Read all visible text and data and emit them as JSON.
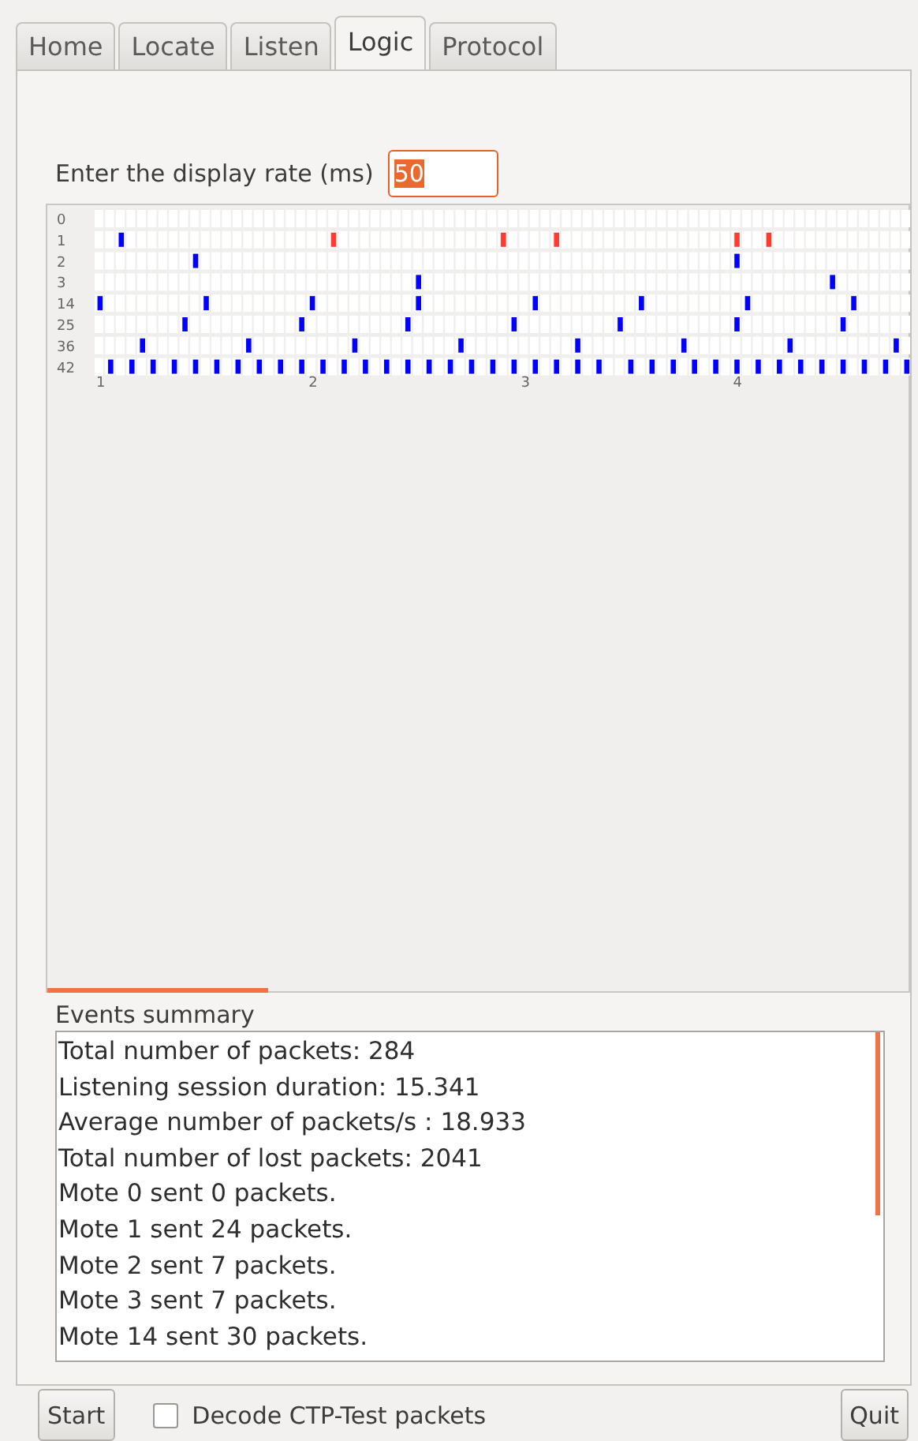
{
  "tabs": [
    {
      "label": "Home",
      "selected": false
    },
    {
      "label": "Locate",
      "selected": false
    },
    {
      "label": "Listen",
      "selected": false
    },
    {
      "label": "Logic",
      "selected": true
    },
    {
      "label": "Protocol",
      "selected": false
    }
  ],
  "rate": {
    "label": "Enter the display rate (ms)",
    "value": "50"
  },
  "logic_view": {
    "rows": [
      {
        "label": "0",
        "cells": [
          {
            "kind": "none"
          },
          {
            "kind": "none"
          },
          {
            "kind": "none"
          },
          {
            "kind": "none"
          },
          {
            "kind": "none"
          },
          {
            "kind": "none"
          },
          {
            "kind": "none"
          },
          {
            "kind": "none"
          },
          {
            "kind": "none"
          },
          {
            "kind": "none"
          },
          {
            "kind": "none"
          },
          {
            "kind": "none"
          },
          {
            "kind": "none"
          },
          {
            "kind": "none"
          },
          {
            "kind": "none"
          },
          {
            "kind": "none"
          },
          {
            "kind": "none"
          },
          {
            "kind": "none"
          },
          {
            "kind": "none"
          },
          {
            "kind": "none"
          },
          {
            "kind": "none"
          },
          {
            "kind": "none"
          },
          {
            "kind": "none"
          },
          {
            "kind": "none"
          },
          {
            "kind": "none"
          },
          {
            "kind": "none"
          },
          {
            "kind": "none"
          },
          {
            "kind": "none"
          },
          {
            "kind": "none"
          },
          {
            "kind": "none"
          },
          {
            "kind": "none"
          },
          {
            "kind": "none"
          },
          {
            "kind": "none"
          },
          {
            "kind": "none"
          },
          {
            "kind": "none"
          },
          {
            "kind": "none"
          },
          {
            "kind": "none"
          },
          {
            "kind": "none"
          },
          {
            "kind": "none"
          },
          {
            "kind": "none"
          },
          {
            "kind": "none"
          },
          {
            "kind": "none"
          },
          {
            "kind": "none"
          },
          {
            "kind": "none"
          },
          {
            "kind": "none"
          },
          {
            "kind": "none"
          },
          {
            "kind": "none"
          },
          {
            "kind": "none"
          },
          {
            "kind": "none"
          },
          {
            "kind": "none"
          },
          {
            "kind": "none"
          },
          {
            "kind": "none"
          },
          {
            "kind": "none"
          },
          {
            "kind": "none"
          },
          {
            "kind": "none"
          },
          {
            "kind": "none"
          },
          {
            "kind": "none"
          },
          {
            "kind": "none"
          },
          {
            "kind": "none"
          },
          {
            "kind": "none"
          },
          {
            "kind": "none"
          },
          {
            "kind": "none"
          },
          {
            "kind": "none"
          },
          {
            "kind": "none"
          },
          {
            "kind": "none"
          },
          {
            "kind": "none"
          },
          {
            "kind": "none"
          },
          {
            "kind": "none"
          },
          {
            "kind": "none"
          },
          {
            "kind": "none"
          },
          {
            "kind": "none"
          },
          {
            "kind": "none"
          },
          {
            "kind": "none"
          },
          {
            "kind": "none"
          },
          {
            "kind": "none"
          },
          {
            "kind": "none"
          },
          {
            "kind": "none"
          }
        ]
      },
      {
        "label": "1",
        "cells": [
          {
            "kind": "none"
          },
          {
            "kind": "none"
          },
          {
            "kind": "rx"
          },
          {
            "kind": "none"
          },
          {
            "kind": "none"
          },
          {
            "kind": "none"
          },
          {
            "kind": "none"
          },
          {
            "kind": "none"
          },
          {
            "kind": "none"
          },
          {
            "kind": "none"
          },
          {
            "kind": "none"
          },
          {
            "kind": "none"
          },
          {
            "kind": "none"
          },
          {
            "kind": "none"
          },
          {
            "kind": "none"
          },
          {
            "kind": "none"
          },
          {
            "kind": "none"
          },
          {
            "kind": "none"
          },
          {
            "kind": "none"
          },
          {
            "kind": "none"
          },
          {
            "kind": "none"
          },
          {
            "kind": "none"
          },
          {
            "kind": "lost"
          },
          {
            "kind": "none"
          },
          {
            "kind": "none"
          },
          {
            "kind": "none"
          },
          {
            "kind": "none"
          },
          {
            "kind": "none"
          },
          {
            "kind": "none"
          },
          {
            "kind": "none"
          },
          {
            "kind": "none"
          },
          {
            "kind": "none"
          },
          {
            "kind": "none"
          },
          {
            "kind": "none"
          },
          {
            "kind": "none"
          },
          {
            "kind": "none"
          },
          {
            "kind": "none"
          },
          {
            "kind": "none"
          },
          {
            "kind": "lost"
          },
          {
            "kind": "none"
          },
          {
            "kind": "none"
          },
          {
            "kind": "none"
          },
          {
            "kind": "none"
          },
          {
            "kind": "lost"
          },
          {
            "kind": "none"
          },
          {
            "kind": "none"
          },
          {
            "kind": "none"
          },
          {
            "kind": "none"
          },
          {
            "kind": "none"
          },
          {
            "kind": "none"
          },
          {
            "kind": "none"
          },
          {
            "kind": "none"
          },
          {
            "kind": "none"
          },
          {
            "kind": "none"
          },
          {
            "kind": "none"
          },
          {
            "kind": "none"
          },
          {
            "kind": "none"
          },
          {
            "kind": "none"
          },
          {
            "kind": "none"
          },
          {
            "kind": "none"
          },
          {
            "kind": "lost"
          },
          {
            "kind": "none"
          },
          {
            "kind": "none"
          },
          {
            "kind": "lost"
          },
          {
            "kind": "none"
          },
          {
            "kind": "none"
          },
          {
            "kind": "none"
          },
          {
            "kind": "none"
          },
          {
            "kind": "none"
          },
          {
            "kind": "none"
          },
          {
            "kind": "none"
          },
          {
            "kind": "none"
          },
          {
            "kind": "none"
          },
          {
            "kind": "none"
          },
          {
            "kind": "none"
          },
          {
            "kind": "none"
          },
          {
            "kind": "none"
          }
        ]
      },
      {
        "label": "2",
        "cells": [
          {
            "kind": "none"
          },
          {
            "kind": "none"
          },
          {
            "kind": "none"
          },
          {
            "kind": "none"
          },
          {
            "kind": "none"
          },
          {
            "kind": "none"
          },
          {
            "kind": "none"
          },
          {
            "kind": "none"
          },
          {
            "kind": "none"
          },
          {
            "kind": "rx"
          },
          {
            "kind": "none"
          },
          {
            "kind": "none"
          },
          {
            "kind": "none"
          },
          {
            "kind": "none"
          },
          {
            "kind": "none"
          },
          {
            "kind": "none"
          },
          {
            "kind": "none"
          },
          {
            "kind": "none"
          },
          {
            "kind": "none"
          },
          {
            "kind": "none"
          },
          {
            "kind": "none"
          },
          {
            "kind": "none"
          },
          {
            "kind": "none"
          },
          {
            "kind": "none"
          },
          {
            "kind": "none"
          },
          {
            "kind": "none"
          },
          {
            "kind": "none"
          },
          {
            "kind": "none"
          },
          {
            "kind": "none"
          },
          {
            "kind": "none"
          },
          {
            "kind": "none"
          },
          {
            "kind": "none"
          },
          {
            "kind": "none"
          },
          {
            "kind": "none"
          },
          {
            "kind": "none"
          },
          {
            "kind": "none"
          },
          {
            "kind": "none"
          },
          {
            "kind": "none"
          },
          {
            "kind": "none"
          },
          {
            "kind": "none"
          },
          {
            "kind": "none"
          },
          {
            "kind": "none"
          },
          {
            "kind": "none"
          },
          {
            "kind": "none"
          },
          {
            "kind": "none"
          },
          {
            "kind": "none"
          },
          {
            "kind": "none"
          },
          {
            "kind": "none"
          },
          {
            "kind": "none"
          },
          {
            "kind": "none"
          },
          {
            "kind": "none"
          },
          {
            "kind": "none"
          },
          {
            "kind": "none"
          },
          {
            "kind": "none"
          },
          {
            "kind": "none"
          },
          {
            "kind": "none"
          },
          {
            "kind": "none"
          },
          {
            "kind": "none"
          },
          {
            "kind": "none"
          },
          {
            "kind": "none"
          },
          {
            "kind": "rx"
          },
          {
            "kind": "none"
          },
          {
            "kind": "none"
          },
          {
            "kind": "none"
          },
          {
            "kind": "none"
          },
          {
            "kind": "none"
          },
          {
            "kind": "none"
          },
          {
            "kind": "none"
          },
          {
            "kind": "none"
          },
          {
            "kind": "none"
          },
          {
            "kind": "none"
          },
          {
            "kind": "none"
          },
          {
            "kind": "none"
          },
          {
            "kind": "none"
          },
          {
            "kind": "none"
          },
          {
            "kind": "none"
          },
          {
            "kind": "none"
          }
        ]
      },
      {
        "label": "3",
        "cells": [
          {
            "kind": "none"
          },
          {
            "kind": "none"
          },
          {
            "kind": "none"
          },
          {
            "kind": "none"
          },
          {
            "kind": "none"
          },
          {
            "kind": "none"
          },
          {
            "kind": "none"
          },
          {
            "kind": "none"
          },
          {
            "kind": "none"
          },
          {
            "kind": "none"
          },
          {
            "kind": "none"
          },
          {
            "kind": "none"
          },
          {
            "kind": "none"
          },
          {
            "kind": "none"
          },
          {
            "kind": "none"
          },
          {
            "kind": "none"
          },
          {
            "kind": "none"
          },
          {
            "kind": "none"
          },
          {
            "kind": "none"
          },
          {
            "kind": "none"
          },
          {
            "kind": "none"
          },
          {
            "kind": "none"
          },
          {
            "kind": "none"
          },
          {
            "kind": "none"
          },
          {
            "kind": "none"
          },
          {
            "kind": "none"
          },
          {
            "kind": "none"
          },
          {
            "kind": "none"
          },
          {
            "kind": "none"
          },
          {
            "kind": "none"
          },
          {
            "kind": "rx"
          },
          {
            "kind": "none"
          },
          {
            "kind": "none"
          },
          {
            "kind": "none"
          },
          {
            "kind": "none"
          },
          {
            "kind": "none"
          },
          {
            "kind": "none"
          },
          {
            "kind": "none"
          },
          {
            "kind": "none"
          },
          {
            "kind": "none"
          },
          {
            "kind": "none"
          },
          {
            "kind": "none"
          },
          {
            "kind": "none"
          },
          {
            "kind": "none"
          },
          {
            "kind": "none"
          },
          {
            "kind": "none"
          },
          {
            "kind": "none"
          },
          {
            "kind": "none"
          },
          {
            "kind": "none"
          },
          {
            "kind": "none"
          },
          {
            "kind": "none"
          },
          {
            "kind": "none"
          },
          {
            "kind": "none"
          },
          {
            "kind": "none"
          },
          {
            "kind": "none"
          },
          {
            "kind": "none"
          },
          {
            "kind": "none"
          },
          {
            "kind": "none"
          },
          {
            "kind": "none"
          },
          {
            "kind": "none"
          },
          {
            "kind": "none"
          },
          {
            "kind": "none"
          },
          {
            "kind": "none"
          },
          {
            "kind": "none"
          },
          {
            "kind": "none"
          },
          {
            "kind": "none"
          },
          {
            "kind": "none"
          },
          {
            "kind": "none"
          },
          {
            "kind": "none"
          },
          {
            "kind": "rx"
          },
          {
            "kind": "none"
          },
          {
            "kind": "none"
          },
          {
            "kind": "none"
          },
          {
            "kind": "none"
          },
          {
            "kind": "none"
          },
          {
            "kind": "none"
          },
          {
            "kind": "none"
          }
        ]
      },
      {
        "label": "14",
        "cells": [
          {
            "kind": "rx"
          },
          {
            "kind": "none"
          },
          {
            "kind": "none"
          },
          {
            "kind": "none"
          },
          {
            "kind": "none"
          },
          {
            "kind": "none"
          },
          {
            "kind": "none"
          },
          {
            "kind": "none"
          },
          {
            "kind": "none"
          },
          {
            "kind": "none"
          },
          {
            "kind": "rx"
          },
          {
            "kind": "none"
          },
          {
            "kind": "none"
          },
          {
            "kind": "none"
          },
          {
            "kind": "none"
          },
          {
            "kind": "none"
          },
          {
            "kind": "none"
          },
          {
            "kind": "none"
          },
          {
            "kind": "none"
          },
          {
            "kind": "none"
          },
          {
            "kind": "rx"
          },
          {
            "kind": "none"
          },
          {
            "kind": "none"
          },
          {
            "kind": "none"
          },
          {
            "kind": "none"
          },
          {
            "kind": "none"
          },
          {
            "kind": "none"
          },
          {
            "kind": "none"
          },
          {
            "kind": "none"
          },
          {
            "kind": "none"
          },
          {
            "kind": "rx"
          },
          {
            "kind": "none"
          },
          {
            "kind": "none"
          },
          {
            "kind": "none"
          },
          {
            "kind": "none"
          },
          {
            "kind": "none"
          },
          {
            "kind": "none"
          },
          {
            "kind": "none"
          },
          {
            "kind": "none"
          },
          {
            "kind": "none"
          },
          {
            "kind": "none"
          },
          {
            "kind": "rx"
          },
          {
            "kind": "none"
          },
          {
            "kind": "none"
          },
          {
            "kind": "none"
          },
          {
            "kind": "none"
          },
          {
            "kind": "none"
          },
          {
            "kind": "none"
          },
          {
            "kind": "none"
          },
          {
            "kind": "none"
          },
          {
            "kind": "none"
          },
          {
            "kind": "rx"
          },
          {
            "kind": "none"
          },
          {
            "kind": "none"
          },
          {
            "kind": "none"
          },
          {
            "kind": "none"
          },
          {
            "kind": "none"
          },
          {
            "kind": "none"
          },
          {
            "kind": "none"
          },
          {
            "kind": "none"
          },
          {
            "kind": "none"
          },
          {
            "kind": "rx"
          },
          {
            "kind": "none"
          },
          {
            "kind": "none"
          },
          {
            "kind": "none"
          },
          {
            "kind": "none"
          },
          {
            "kind": "none"
          },
          {
            "kind": "none"
          },
          {
            "kind": "none"
          },
          {
            "kind": "none"
          },
          {
            "kind": "none"
          },
          {
            "kind": "rx"
          },
          {
            "kind": "none"
          },
          {
            "kind": "none"
          },
          {
            "kind": "none"
          },
          {
            "kind": "none"
          },
          {
            "kind": "none"
          }
        ]
      },
      {
        "label": "25",
        "cells": [
          {
            "kind": "none"
          },
          {
            "kind": "none"
          },
          {
            "kind": "none"
          },
          {
            "kind": "none"
          },
          {
            "kind": "none"
          },
          {
            "kind": "none"
          },
          {
            "kind": "none"
          },
          {
            "kind": "none"
          },
          {
            "kind": "rx"
          },
          {
            "kind": "none"
          },
          {
            "kind": "none"
          },
          {
            "kind": "none"
          },
          {
            "kind": "none"
          },
          {
            "kind": "none"
          },
          {
            "kind": "none"
          },
          {
            "kind": "none"
          },
          {
            "kind": "none"
          },
          {
            "kind": "none"
          },
          {
            "kind": "none"
          },
          {
            "kind": "rx"
          },
          {
            "kind": "none"
          },
          {
            "kind": "none"
          },
          {
            "kind": "none"
          },
          {
            "kind": "none"
          },
          {
            "kind": "none"
          },
          {
            "kind": "none"
          },
          {
            "kind": "none"
          },
          {
            "kind": "none"
          },
          {
            "kind": "none"
          },
          {
            "kind": "rx"
          },
          {
            "kind": "none"
          },
          {
            "kind": "none"
          },
          {
            "kind": "none"
          },
          {
            "kind": "none"
          },
          {
            "kind": "none"
          },
          {
            "kind": "none"
          },
          {
            "kind": "none"
          },
          {
            "kind": "none"
          },
          {
            "kind": "none"
          },
          {
            "kind": "rx"
          },
          {
            "kind": "none"
          },
          {
            "kind": "none"
          },
          {
            "kind": "none"
          },
          {
            "kind": "none"
          },
          {
            "kind": "none"
          },
          {
            "kind": "none"
          },
          {
            "kind": "none"
          },
          {
            "kind": "none"
          },
          {
            "kind": "none"
          },
          {
            "kind": "rx"
          },
          {
            "kind": "none"
          },
          {
            "kind": "none"
          },
          {
            "kind": "none"
          },
          {
            "kind": "none"
          },
          {
            "kind": "none"
          },
          {
            "kind": "none"
          },
          {
            "kind": "none"
          },
          {
            "kind": "none"
          },
          {
            "kind": "none"
          },
          {
            "kind": "none"
          },
          {
            "kind": "rx"
          },
          {
            "kind": "none"
          },
          {
            "kind": "none"
          },
          {
            "kind": "none"
          },
          {
            "kind": "none"
          },
          {
            "kind": "none"
          },
          {
            "kind": "none"
          },
          {
            "kind": "none"
          },
          {
            "kind": "none"
          },
          {
            "kind": "none"
          },
          {
            "kind": "rx"
          },
          {
            "kind": "none"
          },
          {
            "kind": "none"
          },
          {
            "kind": "none"
          },
          {
            "kind": "none"
          },
          {
            "kind": "none"
          },
          {
            "kind": "none"
          }
        ]
      },
      {
        "label": "36",
        "cells": [
          {
            "kind": "none"
          },
          {
            "kind": "none"
          },
          {
            "kind": "none"
          },
          {
            "kind": "none"
          },
          {
            "kind": "rx"
          },
          {
            "kind": "none"
          },
          {
            "kind": "none"
          },
          {
            "kind": "none"
          },
          {
            "kind": "none"
          },
          {
            "kind": "none"
          },
          {
            "kind": "none"
          },
          {
            "kind": "none"
          },
          {
            "kind": "none"
          },
          {
            "kind": "none"
          },
          {
            "kind": "rx"
          },
          {
            "kind": "none"
          },
          {
            "kind": "none"
          },
          {
            "kind": "none"
          },
          {
            "kind": "none"
          },
          {
            "kind": "none"
          },
          {
            "kind": "none"
          },
          {
            "kind": "none"
          },
          {
            "kind": "none"
          },
          {
            "kind": "none"
          },
          {
            "kind": "rx"
          },
          {
            "kind": "none"
          },
          {
            "kind": "none"
          },
          {
            "kind": "none"
          },
          {
            "kind": "none"
          },
          {
            "kind": "none"
          },
          {
            "kind": "none"
          },
          {
            "kind": "none"
          },
          {
            "kind": "none"
          },
          {
            "kind": "none"
          },
          {
            "kind": "rx"
          },
          {
            "kind": "none"
          },
          {
            "kind": "none"
          },
          {
            "kind": "none"
          },
          {
            "kind": "none"
          },
          {
            "kind": "none"
          },
          {
            "kind": "none"
          },
          {
            "kind": "none"
          },
          {
            "kind": "none"
          },
          {
            "kind": "none"
          },
          {
            "kind": "none"
          },
          {
            "kind": "rx"
          },
          {
            "kind": "none"
          },
          {
            "kind": "none"
          },
          {
            "kind": "none"
          },
          {
            "kind": "none"
          },
          {
            "kind": "none"
          },
          {
            "kind": "none"
          },
          {
            "kind": "none"
          },
          {
            "kind": "none"
          },
          {
            "kind": "none"
          },
          {
            "kind": "rx"
          },
          {
            "kind": "none"
          },
          {
            "kind": "none"
          },
          {
            "kind": "none"
          },
          {
            "kind": "none"
          },
          {
            "kind": "none"
          },
          {
            "kind": "none"
          },
          {
            "kind": "none"
          },
          {
            "kind": "none"
          },
          {
            "kind": "none"
          },
          {
            "kind": "rx"
          },
          {
            "kind": "none"
          },
          {
            "kind": "none"
          },
          {
            "kind": "none"
          },
          {
            "kind": "none"
          },
          {
            "kind": "none"
          },
          {
            "kind": "none"
          },
          {
            "kind": "none"
          },
          {
            "kind": "none"
          },
          {
            "kind": "none"
          },
          {
            "kind": "rx"
          },
          {
            "kind": "none"
          }
        ]
      },
      {
        "label": "42",
        "cells": [
          {
            "kind": "none"
          },
          {
            "kind": "rx"
          },
          {
            "kind": "none"
          },
          {
            "kind": "rx"
          },
          {
            "kind": "none"
          },
          {
            "kind": "rx"
          },
          {
            "kind": "none"
          },
          {
            "kind": "rx"
          },
          {
            "kind": "none"
          },
          {
            "kind": "rx"
          },
          {
            "kind": "none"
          },
          {
            "kind": "rx"
          },
          {
            "kind": "none"
          },
          {
            "kind": "rx"
          },
          {
            "kind": "none"
          },
          {
            "kind": "rx"
          },
          {
            "kind": "none"
          },
          {
            "kind": "rx"
          },
          {
            "kind": "none"
          },
          {
            "kind": "rx"
          },
          {
            "kind": "none"
          },
          {
            "kind": "rx"
          },
          {
            "kind": "none"
          },
          {
            "kind": "rx"
          },
          {
            "kind": "none"
          },
          {
            "kind": "rx"
          },
          {
            "kind": "none"
          },
          {
            "kind": "rx"
          },
          {
            "kind": "none"
          },
          {
            "kind": "rx"
          },
          {
            "kind": "none"
          },
          {
            "kind": "rx"
          },
          {
            "kind": "none"
          },
          {
            "kind": "rx"
          },
          {
            "kind": "none"
          },
          {
            "kind": "rx"
          },
          {
            "kind": "none"
          },
          {
            "kind": "rx"
          },
          {
            "kind": "none"
          },
          {
            "kind": "rx"
          },
          {
            "kind": "none"
          },
          {
            "kind": "rx"
          },
          {
            "kind": "none"
          },
          {
            "kind": "rx"
          },
          {
            "kind": "none"
          },
          {
            "kind": "rx"
          },
          {
            "kind": "none"
          },
          {
            "kind": "rx"
          },
          {
            "kind": "none"
          },
          {
            "kind": "none"
          },
          {
            "kind": "rx"
          },
          {
            "kind": "none"
          },
          {
            "kind": "rx"
          },
          {
            "kind": "none"
          },
          {
            "kind": "rx"
          },
          {
            "kind": "none"
          },
          {
            "kind": "rx"
          },
          {
            "kind": "none"
          },
          {
            "kind": "rx"
          },
          {
            "kind": "none"
          },
          {
            "kind": "rx"
          },
          {
            "kind": "none"
          },
          {
            "kind": "rx"
          },
          {
            "kind": "none"
          },
          {
            "kind": "rx"
          },
          {
            "kind": "none"
          },
          {
            "kind": "rx"
          },
          {
            "kind": "none"
          },
          {
            "kind": "rx"
          },
          {
            "kind": "none"
          },
          {
            "kind": "rx"
          },
          {
            "kind": "none"
          },
          {
            "kind": "rx"
          },
          {
            "kind": "none"
          },
          {
            "kind": "rx"
          },
          {
            "kind": "none"
          },
          {
            "kind": "rx"
          }
        ]
      }
    ],
    "ticks": [
      "1",
      "2",
      "3",
      "4"
    ]
  },
  "events": {
    "title": "Events summary",
    "lines": [
      "Total number of packets: 284",
      "Listening session duration: 15.341",
      "Average number of packets/s : 18.933",
      "Total number of lost packets: 2041",
      "Mote 0 sent 0 packets.",
      "Mote 1 sent 24 packets.",
      "Mote 2 sent 7 packets.",
      "Mote 3 sent 7 packets.",
      "Mote 14 sent 30 packets."
    ]
  },
  "start_button": "Start",
  "decode_checkbox": {
    "label": "Decode CTP-Test packets",
    "checked": false
  },
  "quit_button": "Quit"
}
